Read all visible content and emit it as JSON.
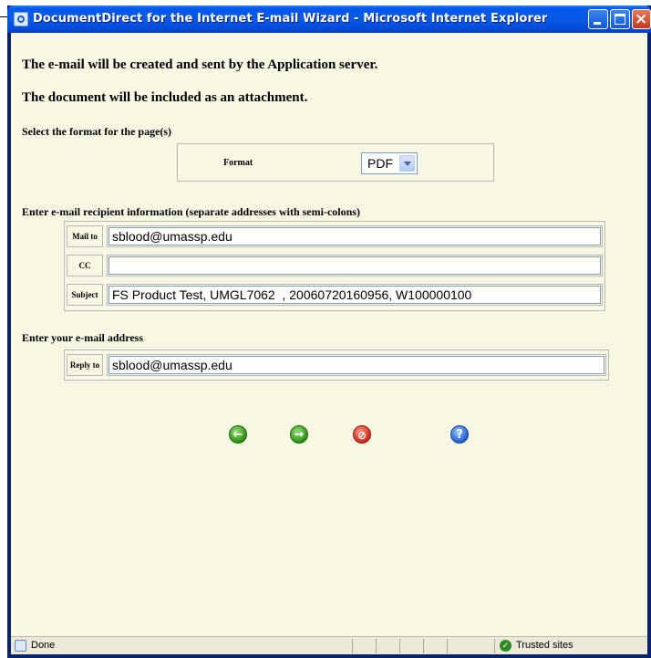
{
  "window": {
    "title": "DocumentDirect for the Internet E-mail Wizard - Microsoft Internet Explorer"
  },
  "content": {
    "line1": "The e-mail will be created and sent by the Application server.",
    "line2": "The document will be included as an attachment.",
    "format_section": {
      "header": "Select the format for the page(s)",
      "label": "Format",
      "selected": "PDF"
    },
    "recipients": {
      "header": "Enter e-mail recipient information (separate addresses with semi-colons)",
      "mail_to_label": "Mail to",
      "mail_to_value": "sblood@umassp.edu",
      "cc_label": "CC",
      "cc_value": "",
      "subject_label": "Subject",
      "subject_value": "FS Product Test, UMGL7062  , 20060720160956, W100000100"
    },
    "reply": {
      "header": "Enter your e-mail address",
      "reply_to_label": "Reply to",
      "reply_to_value": "sblood@umassp.edu"
    },
    "nav": {
      "back_icon": "back-arrow-icon",
      "next_icon": "next-arrow-icon",
      "cancel_icon": "cancel-icon",
      "help_icon": "help-icon"
    }
  },
  "statusbar": {
    "status": "Done",
    "zone": "Trusted sites"
  }
}
